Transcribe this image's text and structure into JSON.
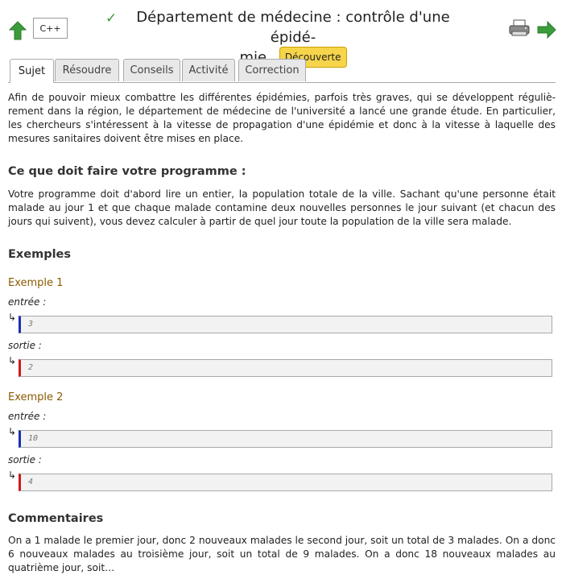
{
  "header": {
    "language": "C++",
    "title": "Département de médecine : contrôle d'une épidé-mie",
    "title_line1": "Département de médecine : contrôle d'une épidé-",
    "title_line2": "mie",
    "level_badge": "Découverte",
    "icons": [
      "arrow-up-icon",
      "check-icon",
      "printer-icon",
      "arrow-right-icon"
    ],
    "colors": {
      "arrow": "#3a9c3a",
      "badge": "#f7d54a"
    }
  },
  "tabs": [
    {
      "label": "Sujet",
      "active": true
    },
    {
      "label": "Résoudre",
      "active": false
    },
    {
      "label": "Conseils",
      "active": false
    },
    {
      "label": "Activité",
      "active": false
    },
    {
      "label": "Correction",
      "active": false
    }
  ],
  "content": {
    "intro": "Afin de pouvoir mieux combattre les différentes épidémies, parfois très graves, qui se développent réguliè­rement dans la région, le département de médecine de l'université a lancé une grande étude. En particulier, les chercheurs s'inté­ressent à la vitesse de propagation d'une épidémie et donc à la vitesse à laquelle des mesures sanitaires doivent être mises en place.",
    "task_heading": "Ce que doit faire votre programme :",
    "task_text": "Votre programme doit d'abord lire un entier, la population totale de la ville. Sachant qu'une personne était malade au jour 1 et que chaque malade contamine deux nouvelles personnes le jour suivant (et chacun des jours qui suivent), vous devez calculer à partir de quel jour toute la population de la ville sera malade.",
    "examples_heading": "Exemples",
    "examples": [
      {
        "title": "Exemple 1",
        "input_label": "entrée :",
        "input": "3",
        "output_label": "sortie :",
        "output": "2"
      },
      {
        "title": "Exemple 2",
        "input_label": "entrée :",
        "input": "10",
        "output_label": "sortie :",
        "output": "4"
      }
    ],
    "io_arrow": "↳",
    "comments_heading": "Commentaires",
    "comments_text": "On a 1 malade le premier jour, donc 2 nouveaux malades le second jour, soit un total de 3 malades. On a donc 6 nou­veaux malades au troisième jour, soit un total de 9 malades. On a donc 18 nouveaux malades au quatrième jour, soit…"
  }
}
